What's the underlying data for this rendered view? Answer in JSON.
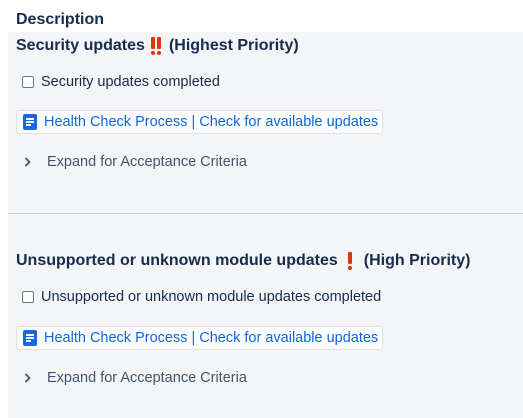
{
  "description": {
    "heading": "Description"
  },
  "sections": [
    {
      "title": "Security updates",
      "priority_label": "(Highest Priority)",
      "priority_icon": "double-exclamation-icon",
      "checkbox_label": "Security updates completed",
      "checkbox_checked": false,
      "link_label": "Health Check Process | Check for available updates",
      "expand_label": "Expand for Acceptance Criteria"
    },
    {
      "title": "Unsupported or unknown module updates",
      "priority_label": "(High Priority)",
      "priority_icon": "exclamation-icon",
      "checkbox_label": "Unsupported or unknown module updates completed",
      "checkbox_checked": false,
      "link_label": "Health Check Process | Check for available updates",
      "expand_label": "Expand for Acceptance Criteria"
    }
  ],
  "colors": {
    "priority_red": "#de350b",
    "link_blue": "#0c66e4",
    "panel_bg": "#f4f5f7",
    "page_icon_blue": "#1868db"
  }
}
